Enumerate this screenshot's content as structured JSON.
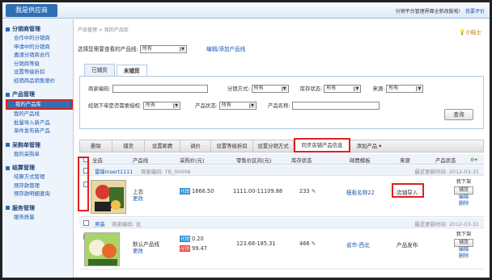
{
  "brand": "我是供应商",
  "top_message": "分销平台管理界面全新改版啦!",
  "top_link": "我要评价",
  "sidebar": [
    {
      "title": "分销商管理",
      "items": [
        "合作中的分销商",
        "申请中的分销商",
        "邀请分销商合作",
        "分销商等级",
        "设置等级折扣",
        "经销商品销售限价"
      ]
    },
    {
      "title": "产品管理",
      "items": [
        "我的产品库",
        "我的产品线",
        "批量导入新产品",
        "单件发布新产品"
      ]
    },
    {
      "title": "采购单管理",
      "items": [
        "我的采购单"
      ]
    },
    {
      "title": "结算管理",
      "items": [
        "结算方式管理",
        "预存款管理",
        "预存款明细查询"
      ]
    },
    {
      "title": "服务管理",
      "items": [
        "服务质量"
      ]
    }
  ],
  "breadcrumb": "产品管理 > 我的产品库",
  "tips": "小贴士",
  "line_select": {
    "label": "选择您需要查看的产品线:",
    "value": "所有",
    "edit_link": "编辑/添加产品线"
  },
  "tabs": [
    "已铺货",
    "未铺货"
  ],
  "filter": {
    "merchant_code_label": "商家编码:",
    "dist_mode_label": "分销方式:",
    "dist_mode_value": "所有",
    "stock_label": "库存状态:",
    "stock_value": "所有",
    "source_label": "来源:",
    "source_value": "所有",
    "auth_label": "经销下单是否需要授权:",
    "auth_value": "所有",
    "product_status_label": "产品状态:",
    "product_status_value": "所有",
    "product_name_label": "产品名称:",
    "search_button": "查询"
  },
  "toolbar": [
    "删除",
    "铺货",
    "设置邮费",
    "调价",
    "设置等级折扣",
    "设置分销方式",
    "同步店铺产品信息",
    "添加产品 ▾"
  ],
  "columns": [
    "全选",
    "产品线",
    "采购价(元)",
    "零售价区间(元)",
    "库存状态",
    "邮费模板",
    "来源",
    "产品状态"
  ],
  "groups": [
    {
      "name": "雷锋insert1111",
      "code": "商家编码: TB_00006",
      "updated": "最近更新时间: 2012-03-31",
      "product": {
        "line": "上衣",
        "edit": "更改",
        "price_badge": "代销",
        "price": "1666.50",
        "retail": "1111.00-11109.88",
        "stock": "233",
        "template": "模板名称22",
        "source": "店铺导入",
        "status": "我下架",
        "btn": "铺货",
        "links": [
          "编辑",
          "删除"
        ]
      }
    },
    {
      "name": "男装",
      "code": "商家编码: 无",
      "updated": "最近更新时间: 2012-03-31",
      "product": {
        "line": "默认产品线",
        "edit": "更改",
        "price_badge": "代销",
        "price": "0.20",
        "price_badge2": "经销",
        "price2": "99.47",
        "retail": "123.68-185.31",
        "stock": "466",
        "template": "省市-西北",
        "source": "产品发布",
        "status": "我下架",
        "btn": "铺货",
        "links": [
          "编辑",
          "删除"
        ]
      }
    }
  ],
  "colors": {
    "accent": "#2f6fb3",
    "highlight": "#e02020",
    "link": "#1a56b0"
  }
}
